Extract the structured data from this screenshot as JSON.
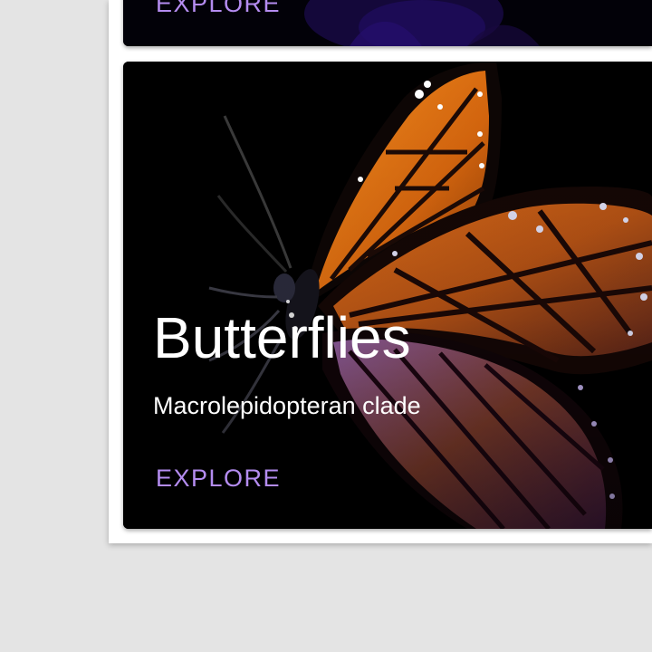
{
  "cards": [
    {
      "action_label": "EXPLORE",
      "image_icon": "iris-flower-image"
    },
    {
      "title": "Butterflies",
      "subtitle": "Macrolepidopteran clade",
      "action_label": "EXPLORE",
      "image_icon": "butterfly-image"
    }
  ],
  "colors": {
    "page_background": "#e4e4e4",
    "panel_background": "#ffffff",
    "card_background": "#000000",
    "action_text": "#b48cf0",
    "title_text": "#ffffff"
  }
}
